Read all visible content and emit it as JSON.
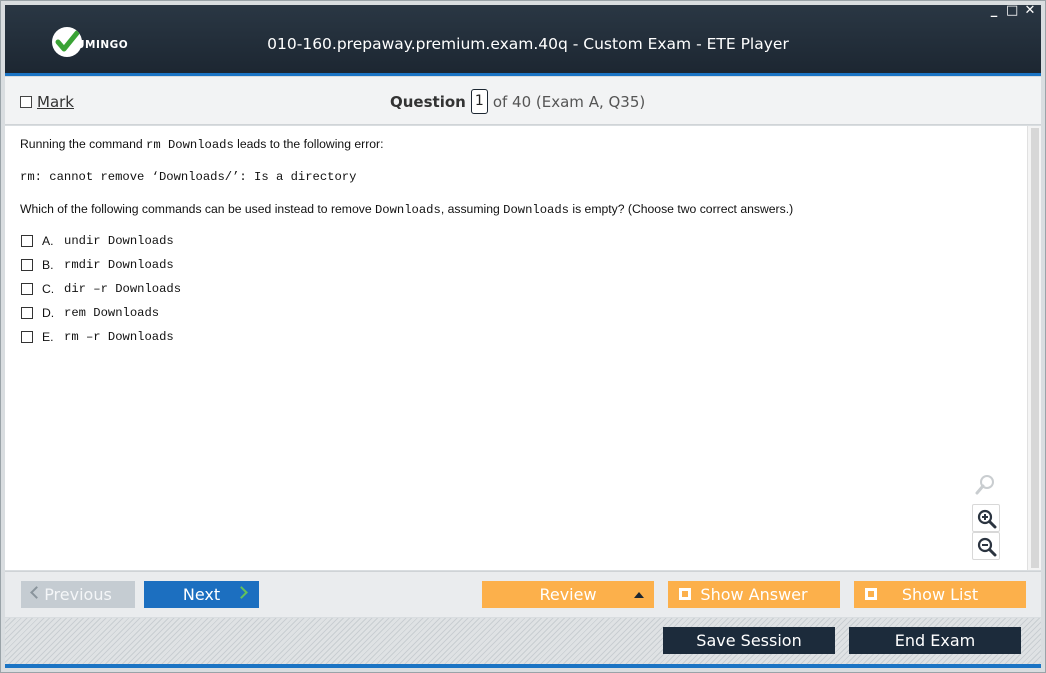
{
  "window": {
    "title": "010-160.prepaway.premium.exam.40q - Custom Exam - ETE Player",
    "logo_text": "UMINGO",
    "controls": {
      "minimize": "_",
      "maximize": "□",
      "close": "✕"
    }
  },
  "header": {
    "mark_label": "Mark",
    "question_label": "Question",
    "question_number": "1",
    "question_suffix": "of 40 (Exam A, Q35)"
  },
  "question": {
    "line1_pre": "Running the command ",
    "line1_code": "rm Downloads",
    "line1_post": " leads to the following error:",
    "error_line": "rm: cannot remove ‘Downloads/’: Is a directory",
    "line3_pre": "Which of the following commands can be used instead to remove ",
    "line3_code1": "Downloads",
    "line3_mid": ", assuming ",
    "line3_code2": "Downloads",
    "line3_post": " is empty? (Choose two correct answers.)",
    "answers": [
      {
        "letter": "A.",
        "text": "undir Downloads"
      },
      {
        "letter": "B.",
        "text": "rmdir Downloads"
      },
      {
        "letter": "C.",
        "text": "dir –r Downloads"
      },
      {
        "letter": "D.",
        "text": "rem Downloads"
      },
      {
        "letter": "E.",
        "text": "rm –r Downloads"
      }
    ]
  },
  "nav": {
    "previous": "Previous",
    "next": "Next",
    "review": "Review",
    "show_answer": "Show Answer",
    "show_list": "Show List",
    "save_session": "Save Session",
    "end_exam": "End Exam"
  },
  "colors": {
    "titlebar": "#1c2631",
    "accent_blue": "#1b74c4",
    "next_button": "#1c6fc0",
    "orange_button": "#fcb04b",
    "dark_button": "#1c2b3b",
    "disabled_button": "#c5ccd2",
    "logo_check": "#3aa335"
  }
}
